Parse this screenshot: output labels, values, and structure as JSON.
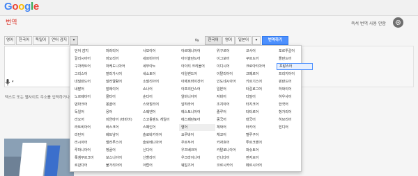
{
  "header": {
    "logo_text": "Google",
    "page_title": "번역",
    "instant_link": "즉석 번역 사용 안함",
    "settings_icon": "gear-icon"
  },
  "source_tabs": [
    "영어",
    "한국어",
    "독일어",
    "언어 감지"
  ],
  "target_tabs": [
    "한국어",
    "영어",
    "일본어"
  ],
  "translate_button": "번역하기",
  "hint": "텍스트 또는 웹사이트 주소를 입력하거나",
  "dropdown_arrow": "▾",
  "swap_glyph": "⇆",
  "dropdown": {
    "columns": [
      [
        "언어 감지",
        "갈리시아어",
        "구자라트어",
        "그리스어",
        "네덜란드어",
        "네팔어",
        "노르웨이어",
        "덴마크어",
        "독일어",
        "라오어",
        "라트비아어",
        "라틴어",
        "러시아어",
        "루마니아어",
        "룩셈부르크어",
        "르완다어"
      ],
      [
        "마라티어",
        "마오리어",
        "마케도니아어",
        "말라가시어",
        "말라얄람어",
        "말레이어",
        "몰타어",
        "몽골어",
        "몽어",
        "미얀마어 (버마어)",
        "바스크어",
        "베트남어",
        "벨라루스어",
        "벵골어",
        "보스니아어",
        "불가리아어"
      ],
      [
        "사모아어",
        "세르비아어",
        "세부아노",
        "세소토어",
        "소말리아어",
        "쇼나어",
        "순다어",
        "스와힐리어",
        "스웨덴어",
        "스코틀랜드 게일어",
        "스페인어",
        "슬로바키아어",
        "슬로베니아어",
        "신디어",
        "신할라어",
        "아랍어"
      ],
      [
        "아르메니아어",
        "아이슬란드어",
        "아이티 크리올어",
        "아일랜드어",
        "아제르바이잔어",
        "아프리칸스어",
        "알바니아어",
        "암하라어",
        "에스토니아어",
        "에스페란토어",
        "영어",
        "요루바어",
        "우르두어",
        "우즈베크어",
        "우크라이나어",
        "웨일즈어"
      ],
      [
        "위구르어",
        "이그보어",
        "이디시어",
        "이탈리아어",
        "인도네시아어",
        "일본어",
        "자바어",
        "조지아어",
        "줄루어",
        "중국어",
        "체와어",
        "체코어",
        "카자흐어",
        "카탈로니아어",
        "칸나다어",
        "코르시카어"
      ],
      [
        "코사어",
        "쿠르드어",
        "크로아티아어",
        "크메르어",
        "키르기스어",
        "타갈로그어",
        "타밀어",
        "타지크어",
        "타타르어",
        "태국어",
        "터키어",
        "텔루구어",
        "투르크멘어",
        "파슈토어",
        "펀자브어",
        "페르시아어"
      ],
      [
        "포르투갈어",
        "폴란드어",
        "프랑스어",
        "프리지아어",
        "핀란드어",
        "하와이어",
        "하우사어",
        "한국어",
        "헝가리어",
        "히브리어",
        "힌디어"
      ]
    ],
    "hovered": "영어",
    "current": "프랑스어"
  }
}
